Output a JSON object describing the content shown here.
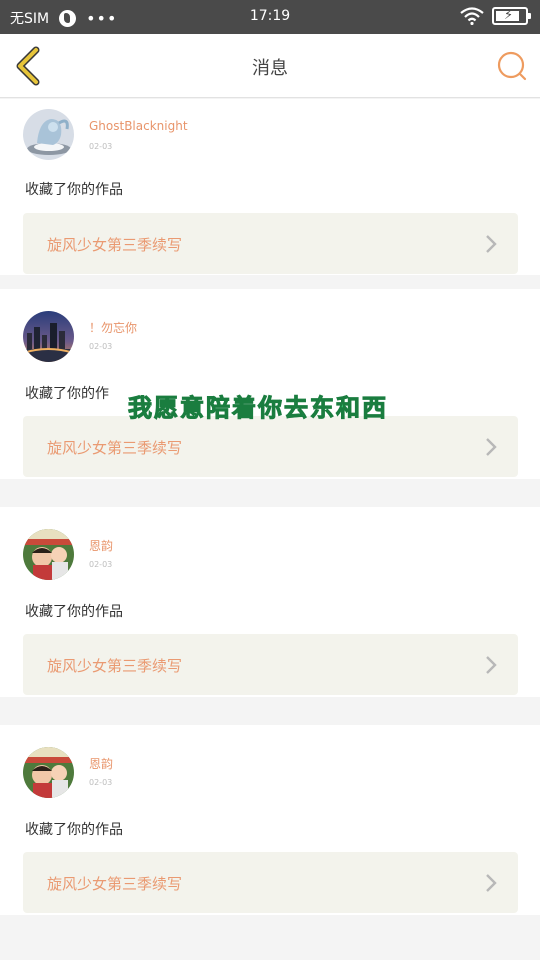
{
  "status_bar": {
    "carrier": "无SIM",
    "extra": "•••",
    "time": "17:19",
    "battery_level": 0.85
  },
  "header": {
    "title": "消息",
    "accent": "#e7c53a",
    "search_color": "#ee9b5f"
  },
  "messages": [
    {
      "username": "GhostBlacknight",
      "date": "02-03",
      "action": "收藏了你的作品",
      "work_title": "旋风少女第三季续写",
      "avatar": "dragon"
    },
    {
      "username": "！勿忘你",
      "date": "02-03",
      "action": "收藏了你的作",
      "work_title": "旋风少女第三季续写",
      "avatar": "city-night"
    },
    {
      "username": "恩韵",
      "date": "02-03",
      "action": "收藏了你的作品",
      "work_title": "旋风少女第三季续写",
      "avatar": "family-photo"
    },
    {
      "username": "恩韵",
      "date": "02-03",
      "action": "收藏了你的作品",
      "work_title": "旋风少女第三季续写",
      "avatar": "family-photo"
    }
  ],
  "overlay": {
    "text": "我愿意陪着你去东和西",
    "color": "#3ed27a"
  }
}
